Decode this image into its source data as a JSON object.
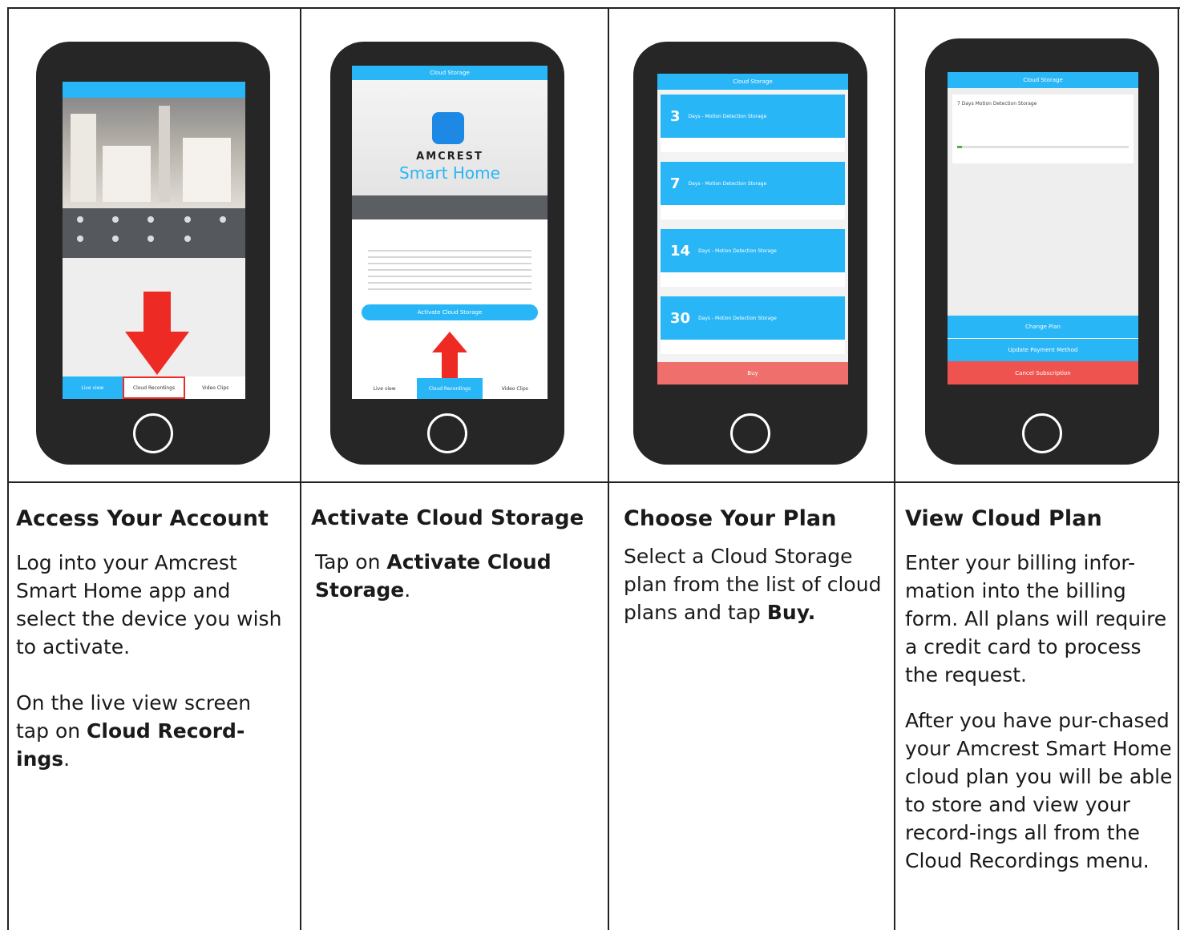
{
  "columns": [
    {
      "title": "Access Your Account",
      "body": [
        "Log into your Amcrest Smart Home app and select the device you wish to activate."
      ],
      "body2_pre": "On the live view screen tap on ",
      "body2_bold": "Cloud Record-ings",
      "body2_post": ".",
      "screen": {
        "bottom_tabs": [
          "Live view",
          "Cloud Recordings",
          "Video Clips"
        ]
      }
    },
    {
      "title": "Activate Cloud Storage",
      "body_pre": "Tap on ",
      "body_bold": "Activate Cloud Storage",
      "body_post": ".",
      "screen": {
        "header": "Cloud Storage",
        "logo_line1": "AMCREST",
        "logo_line2": "Smart Home",
        "activate_button": "Activate Cloud Storage",
        "bottom_tabs": [
          "Live view",
          "Cloud Recordings",
          "Video Clips"
        ]
      }
    },
    {
      "title": "Choose Your Plan",
      "body_pre": "Select a Cloud Storage plan from the list of cloud plans and tap ",
      "body_bold": "Buy.",
      "screen": {
        "header": "Cloud Storage",
        "plans": [
          {
            "days": "3",
            "label": "Days - Motion Detection Storage"
          },
          {
            "days": "7",
            "label": "Days - Motion Detection Storage"
          },
          {
            "days": "14",
            "label": "Days - Motion Detection Storage"
          },
          {
            "days": "30",
            "label": "Days - Motion Detection Storage"
          }
        ],
        "buy_button": "Buy"
      }
    },
    {
      "title": "View Cloud Plan",
      "body": [
        "Enter your billing infor-mation into the billing form. All plans will require a credit card to process the request."
      ],
      "body2": "After you have pur-chased your Amcrest Smart Home cloud plan you will be able to store and view your record-ings all from the Cloud Recordings menu.",
      "screen": {
        "header": "Cloud Storage",
        "plan_line": "7 Days Motion Detection Storage",
        "buttons": [
          "Change Plan",
          "Update Payment Method",
          "Cancel Subscription"
        ]
      }
    }
  ],
  "colors": {
    "blue": "#29b6f6",
    "red": "#ee2a24",
    "phone": "#262626",
    "red_button": "#ef5350"
  }
}
